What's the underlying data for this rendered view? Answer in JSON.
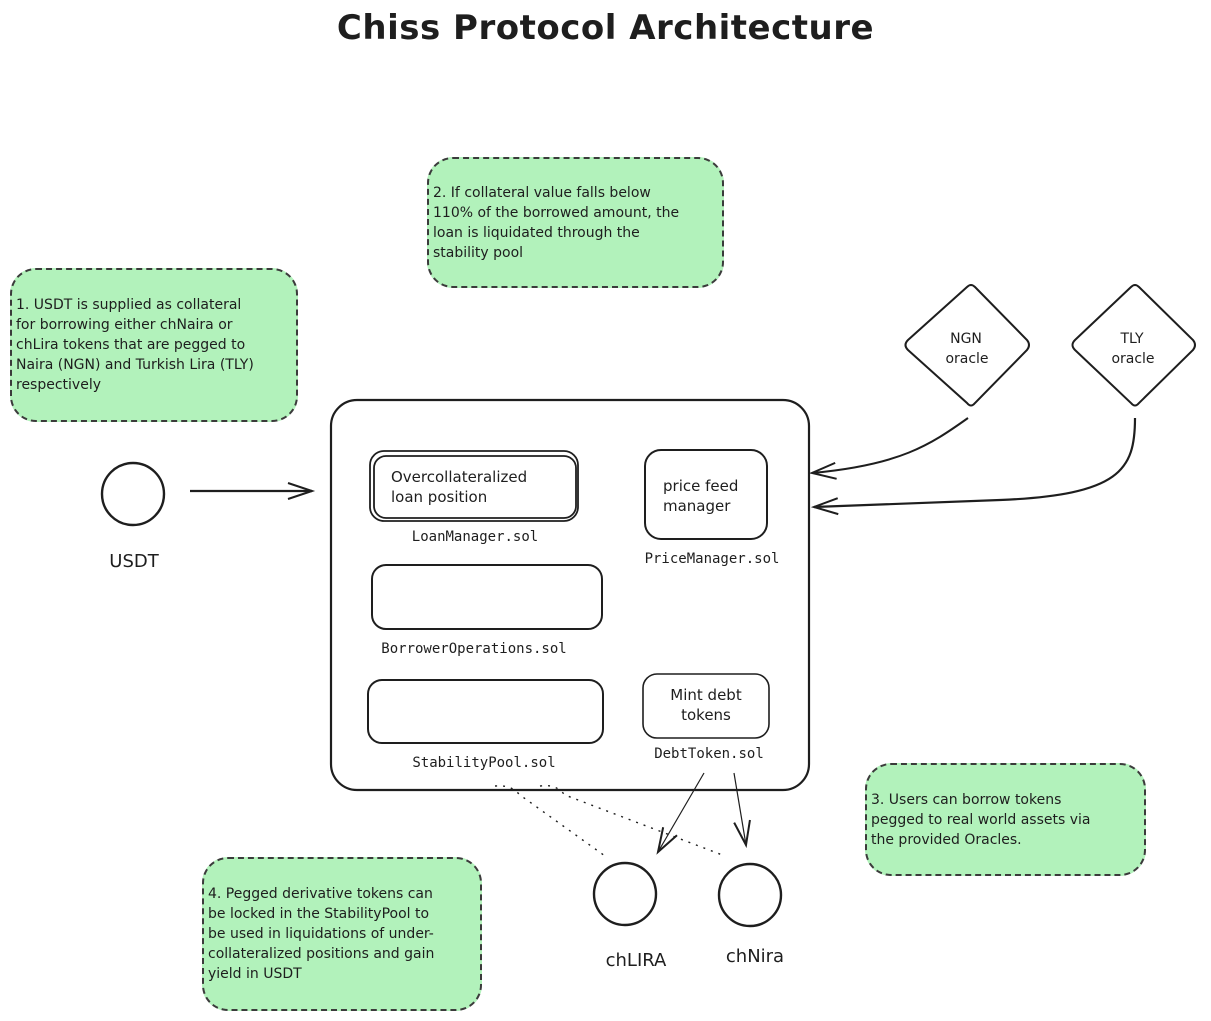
{
  "title": "Chiss Protocol Architecture",
  "notes": [
    {
      "id": "note-1",
      "text": "  1. USDT is supplied as collateral\nfor borrowing either chNaira or\nchLira tokens that are pegged to\nNaira (NGN) and Turkish Lira (TLY)\nrespectively"
    },
    {
      "id": "note-2",
      "text": "   2. If collateral value falls below\n110% of the borrowed amount, the\nloan is liquidated through the\nstability pool"
    },
    {
      "id": "note-3",
      "text": "3. Users can borrow tokens\npegged to real world assets via\nthe provided Oracles."
    },
    {
      "id": "note-4",
      "text": "4. Pegged derivative tokens can\nbe locked in the StabilityPool to\nbe used in liquidations of under-\ncollateralized positions and gain\nyield in USDT"
    }
  ],
  "tokens": {
    "usdt": "USDT",
    "chlira": "chLIRA",
    "chnira": "chNira"
  },
  "oracles": [
    {
      "line1": "NGN",
      "line2": "oracle"
    },
    {
      "line1": "TLY",
      "line2": "oracle"
    }
  ],
  "contracts": {
    "loan_manager": {
      "inner_line1": "Overcollateralized",
      "inner_line2": "loan position",
      "label": "LoanManager.sol"
    },
    "price_manager": {
      "inner_line1": "price feed",
      "inner_line2": "manager",
      "label": "PriceManager.sol"
    },
    "borrower_operations": {
      "label": "BorrowerOperations.sol"
    },
    "stability_pool": {
      "label": "StabilityPool.sol"
    },
    "debt_token": {
      "inner_line1": "Mint debt",
      "inner_line2": "tokens",
      "label": "DebtToken.sol"
    }
  },
  "colors": {
    "note_fill": "#b2f2bb",
    "stroke": "#1e1e1e",
    "background": "#ffffff"
  }
}
